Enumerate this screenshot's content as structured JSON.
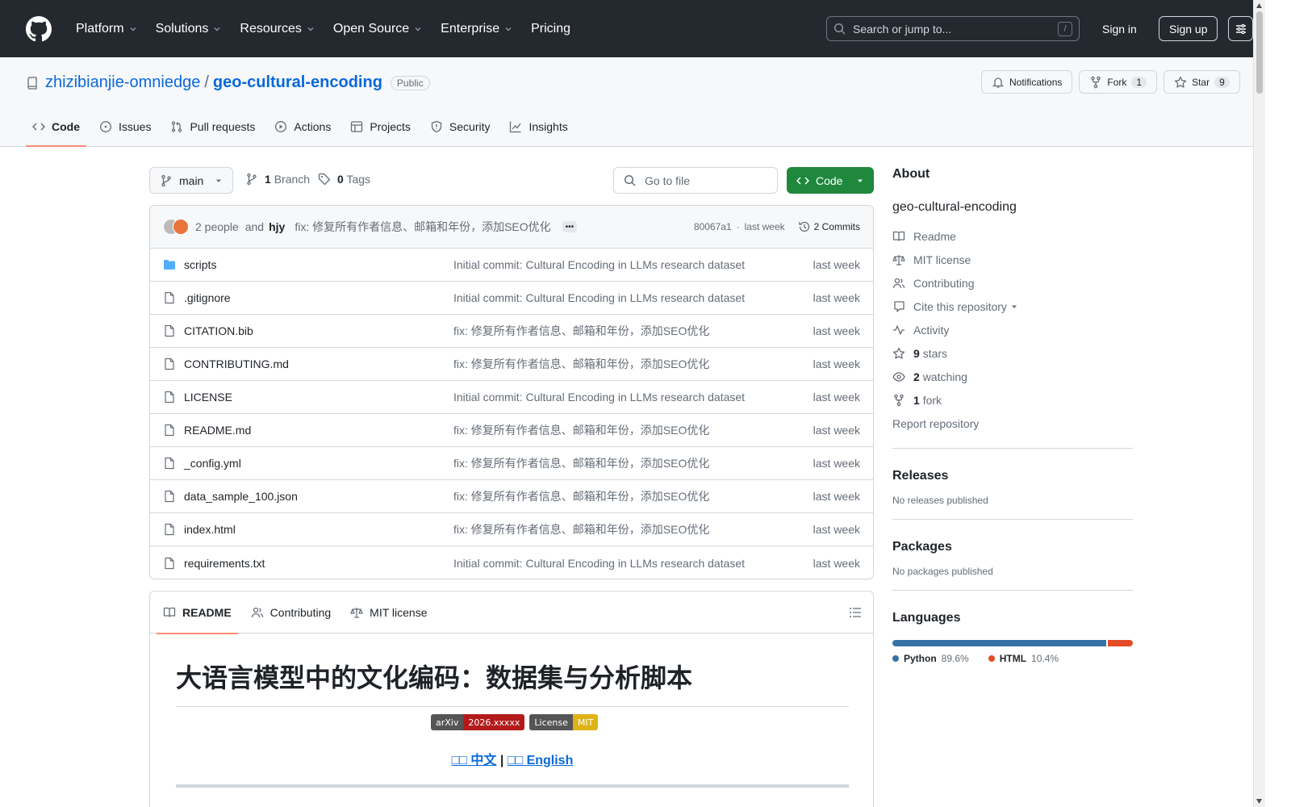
{
  "header": {
    "nav": [
      "Platform",
      "Solutions",
      "Resources",
      "Open Source",
      "Enterprise",
      "Pricing"
    ],
    "search_placeholder": "Search or jump to...",
    "search_kbd": "/",
    "sign_in": "Sign in",
    "sign_up": "Sign up"
  },
  "repo": {
    "owner": "zhizibianjie-omniedge",
    "separator": "/",
    "name": "geo-cultural-encoding",
    "visibility": "Public",
    "notifications": "Notifications",
    "fork_label": "Fork",
    "fork_count": "1",
    "star_label": "Star",
    "star_count": "9"
  },
  "tabs": [
    "Code",
    "Issues",
    "Pull requests",
    "Actions",
    "Projects",
    "Security",
    "Insights"
  ],
  "branch_bar": {
    "branch": "main",
    "branch_count": "1",
    "branch_label": "Branch",
    "tag_count": "0",
    "tag_label": "Tags",
    "goto_placeholder": "Go to file",
    "code_button": "Code"
  },
  "commit": {
    "people": "2 people",
    "and": "and",
    "author": "hjy",
    "message": "fix: 修复所有作者信息、邮箱和年份，添加SEO优化",
    "hash": "80067a1",
    "dot": "·",
    "time": "last week",
    "count": "2 Commits"
  },
  "files": [
    {
      "name": "scripts",
      "type": "dir",
      "msg": "Initial commit: Cultural Encoding in LLMs research dataset",
      "date": "last week"
    },
    {
      "name": ".gitignore",
      "type": "file",
      "msg": "Initial commit: Cultural Encoding in LLMs research dataset",
      "date": "last week"
    },
    {
      "name": "CITATION.bib",
      "type": "file",
      "msg": "fix: 修复所有作者信息、邮箱和年份，添加SEO优化",
      "date": "last week"
    },
    {
      "name": "CONTRIBUTING.md",
      "type": "file",
      "msg": "fix: 修复所有作者信息、邮箱和年份，添加SEO优化",
      "date": "last week"
    },
    {
      "name": "LICENSE",
      "type": "file",
      "msg": "Initial commit: Cultural Encoding in LLMs research dataset",
      "date": "last week"
    },
    {
      "name": "README.md",
      "type": "file",
      "msg": "fix: 修复所有作者信息、邮箱和年份，添加SEO优化",
      "date": "last week"
    },
    {
      "name": "_config.yml",
      "type": "file",
      "msg": "fix: 修复所有作者信息、邮箱和年份，添加SEO优化",
      "date": "last week"
    },
    {
      "name": "data_sample_100.json",
      "type": "file",
      "msg": "fix: 修复所有作者信息、邮箱和年份，添加SEO优化",
      "date": "last week"
    },
    {
      "name": "index.html",
      "type": "file",
      "msg": "fix: 修复所有作者信息、邮箱和年份，添加SEO优化",
      "date": "last week"
    },
    {
      "name": "requirements.txt",
      "type": "file",
      "msg": "Initial commit: Cultural Encoding in LLMs research dataset",
      "date": "last week"
    }
  ],
  "readme": {
    "tabs": [
      "README",
      "Contributing",
      "MIT license"
    ],
    "title": "大语言模型中的文化编码：数据集与分析脚本",
    "shields": [
      {
        "label": "arXiv",
        "value": "2026.xxxxx",
        "color": "#b31b1b"
      },
      {
        "label": "License",
        "value": "MIT",
        "color": "#dfb317"
      }
    ],
    "lang_zh": "□□ 中文",
    "lang_sep": " | ",
    "lang_en": "□□ English"
  },
  "sidebar": {
    "about_title": "About",
    "description": "geo-cultural-encoding",
    "links": {
      "readme": "Readme",
      "license": "MIT license",
      "contributing": "Contributing",
      "cite": "Cite this repository",
      "activity": "Activity",
      "stars_count": "9",
      "stars_label": "stars",
      "watching_count": "2",
      "watching_label": "watching",
      "fork_count": "1",
      "fork_label": "fork",
      "report": "Report repository"
    },
    "releases_title": "Releases",
    "releases_empty": "No releases published",
    "packages_title": "Packages",
    "packages_empty": "No packages published",
    "languages_title": "Languages",
    "languages": [
      {
        "name": "Python",
        "percent": "89.6%",
        "share": 89.6,
        "color": "#3572A5"
      },
      {
        "name": "HTML",
        "percent": "10.4%",
        "share": 10.4,
        "color": "#e34c26"
      }
    ]
  }
}
